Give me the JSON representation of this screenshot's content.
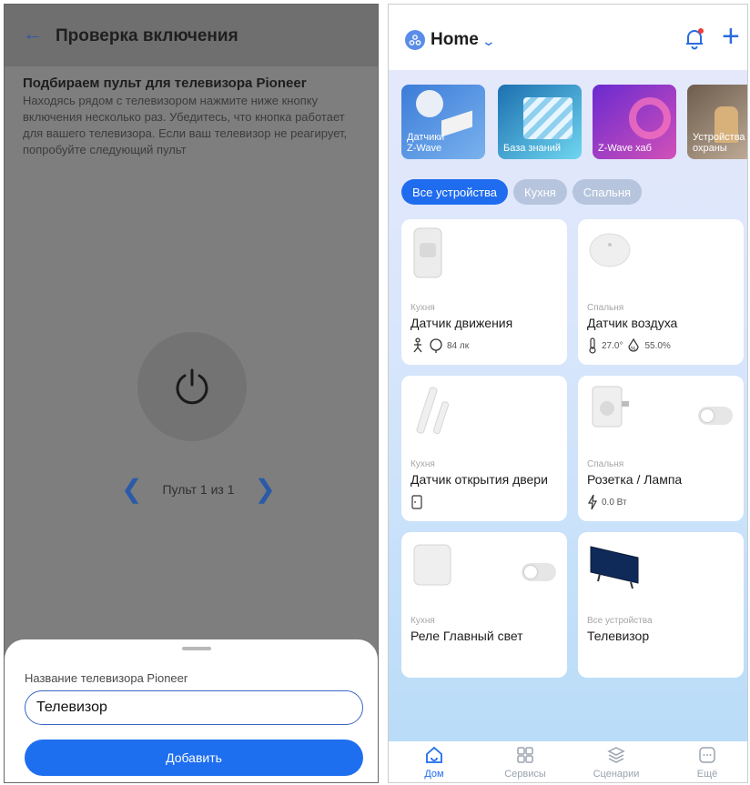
{
  "left": {
    "title": "Проверка включения",
    "heading": "Подбираем пульт для телевизора Pioneer",
    "description": "Находясь рядом с телевизором нажмите ниже кнопку включения несколько раз. Убедитесь, что кнопка работает для вашего телевизора. Если ваш телевизор не реагирует, попробуйте следующий пульт",
    "pager_text": "Пульт 1 из 1",
    "sheet": {
      "label": "Название телевизора Pioneer",
      "input_value": "Телевизор",
      "add_label": "Добавить"
    }
  },
  "right": {
    "home_title": "Home",
    "categories": [
      {
        "label": "Датчики\nZ-Wave"
      },
      {
        "label": "База знаний"
      },
      {
        "label": "Z-Wave хаб"
      },
      {
        "label": "Устройства\nохраны"
      }
    ],
    "chips": [
      "Все устройства",
      "Кухня",
      "Спальня"
    ],
    "cards": [
      {
        "room": "Кухня",
        "name": "Датчик движения",
        "metric": "84 лк"
      },
      {
        "room": "Спальня",
        "name": "Датчик воздуха",
        "metric1": "27.0°",
        "metric2": "55.0%"
      },
      {
        "room": "Кухня",
        "name": "Датчик открытия двери"
      },
      {
        "room": "Спальня",
        "name": "Розетка / Лампа",
        "metric": "0.0 Вт"
      },
      {
        "room": "Кухня",
        "name": "Реле Главный свет"
      },
      {
        "room": "Все устройства",
        "name": "Телевизор"
      }
    ],
    "tabs": [
      "Дом",
      "Сервисы",
      "Сценарии",
      "Ещё"
    ]
  },
  "colors": {
    "accent": "#1f6cef",
    "overlay": "#7e7e7e"
  }
}
